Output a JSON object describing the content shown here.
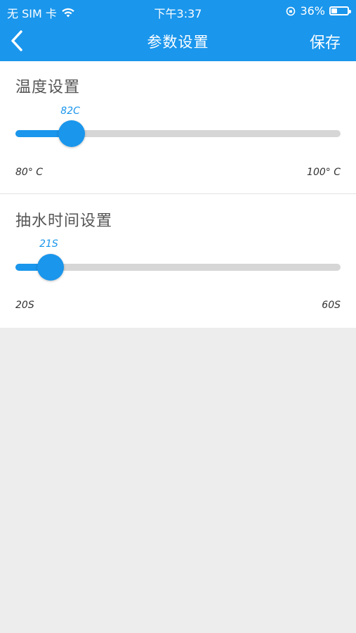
{
  "status_bar": {
    "carrier": "无 SIM 卡",
    "time": "下午3:37",
    "battery": "36%",
    "battery_level": 0.36
  },
  "header": {
    "back_icon": "chevron-left-icon",
    "title": "参数设置",
    "save_label": "保存"
  },
  "temperature": {
    "title": "温度设置",
    "value_label": "82C",
    "value": 82,
    "min": 80,
    "max": 100,
    "min_label": "80° C",
    "max_label": "100° C"
  },
  "pump": {
    "title": "抽水时间设置",
    "value_label": "21S",
    "value": 21,
    "min": 20,
    "max": 60,
    "min_label": "20S",
    "max_label": "60S"
  },
  "colors": {
    "accent": "#1a96ec",
    "track": "#d6d6d6",
    "background": "#ededed"
  }
}
